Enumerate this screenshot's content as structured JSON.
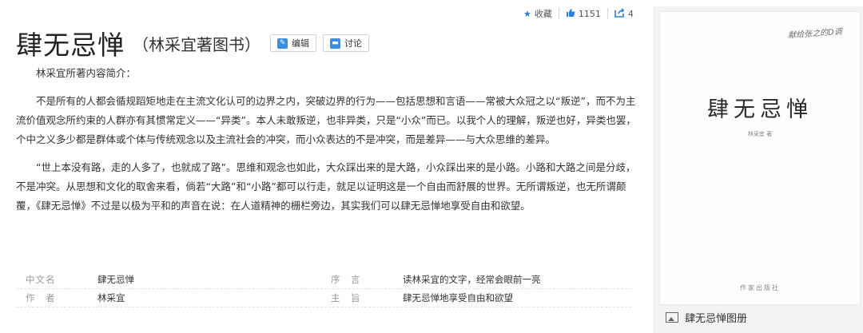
{
  "toolbar": {
    "favorite_label": "收藏",
    "like_count": "1151",
    "share_count": "4"
  },
  "header": {
    "title": "肆无忌惮",
    "subtitle": "（林采宜著图书）",
    "edit_label": "编辑",
    "discuss_label": "讨论"
  },
  "content": {
    "intro": "林采宜所著内容简介：",
    "paragraph1": "不是所有的人都会循规蹈矩地走在主流文化认可的边界之内，突破边界的行为——包括思想和言语——常被大众冠之以“叛逆”，而不为主流价值观念所约束的人群亦有其惯常定义——“异类”。本人未敢叛逆，也非异类，只是“小众”而已。以我个人的理解，叛逆也好，异类也罢，个中之义多少都是群体或个体与传统观念以及主流社会的冲突，而小众表达的不是冲突，而是差异——与大众思维的差异。",
    "paragraph2": "“世上本没有路，走的人多了，也就成了路”。思维和观念也如此，大众踩出来的是大路，小众踩出来的是小路。小路和大路之间是分歧，不是冲突。从思想和文化的取舍来看，倘若“大路”和“小路”都可以行走，就足以证明这是一个自由而舒展的世界。无所谓叛逆，也无所谓颠覆，《肆无忌惮》不过是以极为平和的声音在说：在人道精神的栅栏旁边，其实我们可以肆无忌惮地享受自由和欲望。"
  },
  "info": {
    "rows": [
      {
        "label1": "中文名",
        "value1": "肆无忌惮",
        "label2": "序　言",
        "value2": "读林采宜的文字，经常会眼前一亮"
      },
      {
        "label1": "作　者",
        "value1": "林采宜",
        "label2": "主　旨",
        "value2": "肆无忌惮地享受自由和欲望"
      }
    ]
  },
  "cover": {
    "handwriting": "献给张之的D调",
    "title": "肆无忌惮",
    "author": "林采宜 著",
    "publisher": "作家出版社"
  },
  "album": {
    "label": "肆无忌惮图册"
  },
  "colors": {
    "accent": "#2f7fd3",
    "button_icon": "#3a8ee6",
    "panel_bg": "#f3f3f3"
  },
  "icons": {
    "favorite": "star-icon",
    "like": "thumbs-up-icon",
    "share": "share-icon",
    "edit": "pencil-icon",
    "discuss": "comment-icon",
    "album": "image-icon"
  }
}
